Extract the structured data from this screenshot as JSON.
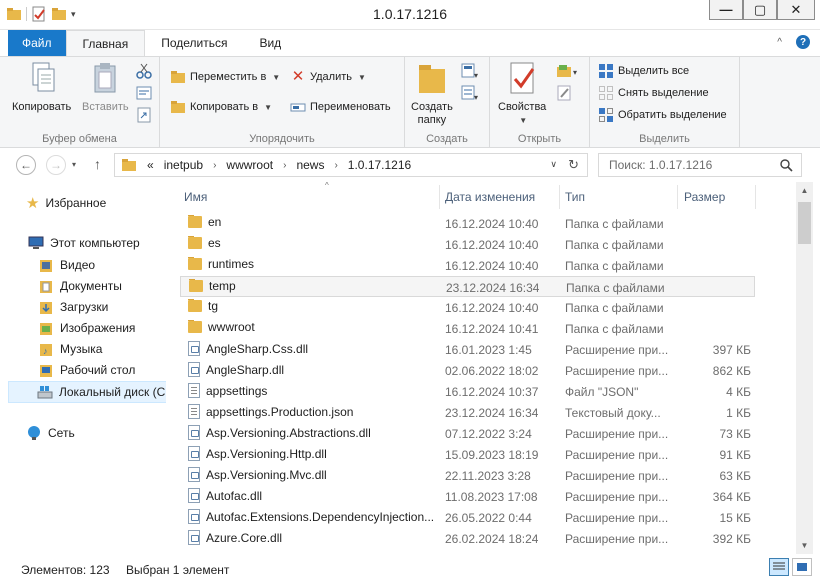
{
  "window": {
    "title": "1.0.17.1216"
  },
  "ribbon_tabs": [
    "Файл",
    "Главная",
    "Поделиться",
    "Вид"
  ],
  "clipboard": {
    "copy": "Копировать",
    "paste": "Вставить",
    "label": "Буфер обмена"
  },
  "organize": {
    "move": "Переместить в",
    "copy_to": "Копировать в",
    "delete": "Удалить",
    "rename": "Переименовать",
    "label": "Упорядочить"
  },
  "create": {
    "new_folder_line1": "Создать",
    "new_folder_line2": "папку",
    "label": "Создать"
  },
  "open": {
    "properties": "Свойства",
    "label": "Открыть"
  },
  "select": {
    "all": "Выделить все",
    "none": "Снять выделение",
    "invert": "Обратить выделение",
    "label": "Выделить"
  },
  "address": {
    "prefix": "«",
    "crumbs": [
      "inetpub",
      "wwwroot",
      "news",
      "1.0.17.1216"
    ]
  },
  "search": {
    "placeholder": "Поиск: 1.0.17.1216"
  },
  "nav": {
    "favorites": "Избранное",
    "computer": "Этот компьютер",
    "children": [
      "Видео",
      "Документы",
      "Загрузки",
      "Изображения",
      "Музыка",
      "Рабочий стол",
      "Локальный диск (C"
    ],
    "network": "Сеть"
  },
  "columns": {
    "name": "Имя",
    "date": "Дата изменения",
    "type": "Тип",
    "size": "Размер"
  },
  "files": [
    {
      "name": "en",
      "date": "16.12.2024 10:40",
      "type": "Папка с файлами",
      "size": "",
      "icon": "folder"
    },
    {
      "name": "es",
      "date": "16.12.2024 10:40",
      "type": "Папка с файлами",
      "size": "",
      "icon": "folder"
    },
    {
      "name": "runtimes",
      "date": "16.12.2024 10:40",
      "type": "Папка с файлами",
      "size": "",
      "icon": "folder"
    },
    {
      "name": "temp",
      "date": "23.12.2024 16:34",
      "type": "Папка с файлами",
      "size": "",
      "icon": "folder",
      "selected": true
    },
    {
      "name": "tg",
      "date": "16.12.2024 10:40",
      "type": "Папка с файлами",
      "size": "",
      "icon": "folder"
    },
    {
      "name": "wwwroot",
      "date": "16.12.2024 10:41",
      "type": "Папка с файлами",
      "size": "",
      "icon": "folder"
    },
    {
      "name": "AngleSharp.Css.dll",
      "date": "16.01.2023 1:45",
      "type": "Расширение при...",
      "size": "397 КБ",
      "icon": "dll"
    },
    {
      "name": "AngleSharp.dll",
      "date": "02.06.2022 18:02",
      "type": "Расширение при...",
      "size": "862 КБ",
      "icon": "dll"
    },
    {
      "name": "appsettings",
      "date": "16.12.2024 10:37",
      "type": "Файл \"JSON\"",
      "size": "4 КБ",
      "icon": "txt"
    },
    {
      "name": "appsettings.Production.json",
      "date": "23.12.2024 16:34",
      "type": "Текстовый доку...",
      "size": "1 КБ",
      "icon": "txt"
    },
    {
      "name": "Asp.Versioning.Abstractions.dll",
      "date": "07.12.2022 3:24",
      "type": "Расширение при...",
      "size": "73 КБ",
      "icon": "dll"
    },
    {
      "name": "Asp.Versioning.Http.dll",
      "date": "15.09.2023 18:19",
      "type": "Расширение при...",
      "size": "91 КБ",
      "icon": "dll"
    },
    {
      "name": "Asp.Versioning.Mvc.dll",
      "date": "22.11.2023 3:28",
      "type": "Расширение при...",
      "size": "63 КБ",
      "icon": "dll"
    },
    {
      "name": "Autofac.dll",
      "date": "11.08.2023 17:08",
      "type": "Расширение при...",
      "size": "364 КБ",
      "icon": "dll"
    },
    {
      "name": "Autofac.Extensions.DependencyInjection...",
      "date": "26.05.2022 0:44",
      "type": "Расширение при...",
      "size": "15 КБ",
      "icon": "dll"
    },
    {
      "name": "Azure.Core.dll",
      "date": "26.02.2024 18:24",
      "type": "Расширение при...",
      "size": "392 КБ",
      "icon": "dll"
    }
  ],
  "status": {
    "count": "Элементов: 123",
    "selected": "Выбран 1 элемент"
  }
}
